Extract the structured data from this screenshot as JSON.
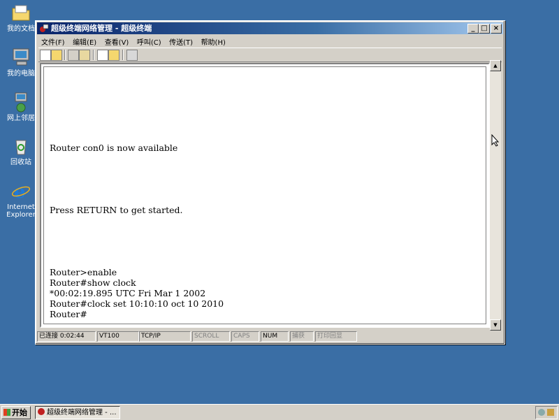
{
  "desktop": {
    "icons": [
      {
        "label": "我的文档",
        "icon": "folder-icon"
      },
      {
        "label": "我的电脑",
        "icon": "computer-icon"
      },
      {
        "label": "网上邻居",
        "icon": "network-icon"
      },
      {
        "label": "回收站",
        "icon": "recycle-bin-icon"
      },
      {
        "label_line1": "Internet",
        "label_line2": "Explorer",
        "icon": "ie-icon"
      }
    ]
  },
  "window": {
    "title": "超级终端网络管理 - 超级终端",
    "controls": {
      "minimize": "_",
      "maximize": "□",
      "close": "×"
    },
    "menu": [
      "文件(F)",
      "编辑(E)",
      "查看(V)",
      "呼叫(C)",
      "传送(T)",
      "帮助(H)"
    ],
    "toolbar_icons": [
      "new-icon",
      "open-icon",
      "disconnect-icon",
      "properties-icon",
      "send-icon",
      "receive-icon",
      "settings-icon"
    ],
    "terminal_lines": [
      "Router con0 is now available",
      "Press RETURN to get started.",
      "Router>enable",
      "Router#show clock",
      "*00:02:19.895 UTC Fri Mar 1 2002",
      "Router#clock set 10:10:10 oct 10 2010",
      "Router#"
    ],
    "status": {
      "connected": "已连接 0:02:44",
      "emulation": "VT100",
      "protocol": "TCP/IP",
      "scroll": "SCROLL",
      "caps": "CAPS",
      "num": "NUM",
      "capture": "捕获",
      "print_echo": "打印回显"
    }
  },
  "taskbar": {
    "start_label": "开始",
    "task_label": "超级终端网络管理 - ..."
  },
  "colors": {
    "desktop": "#3a6ea5",
    "title_active": "#0a246a"
  }
}
